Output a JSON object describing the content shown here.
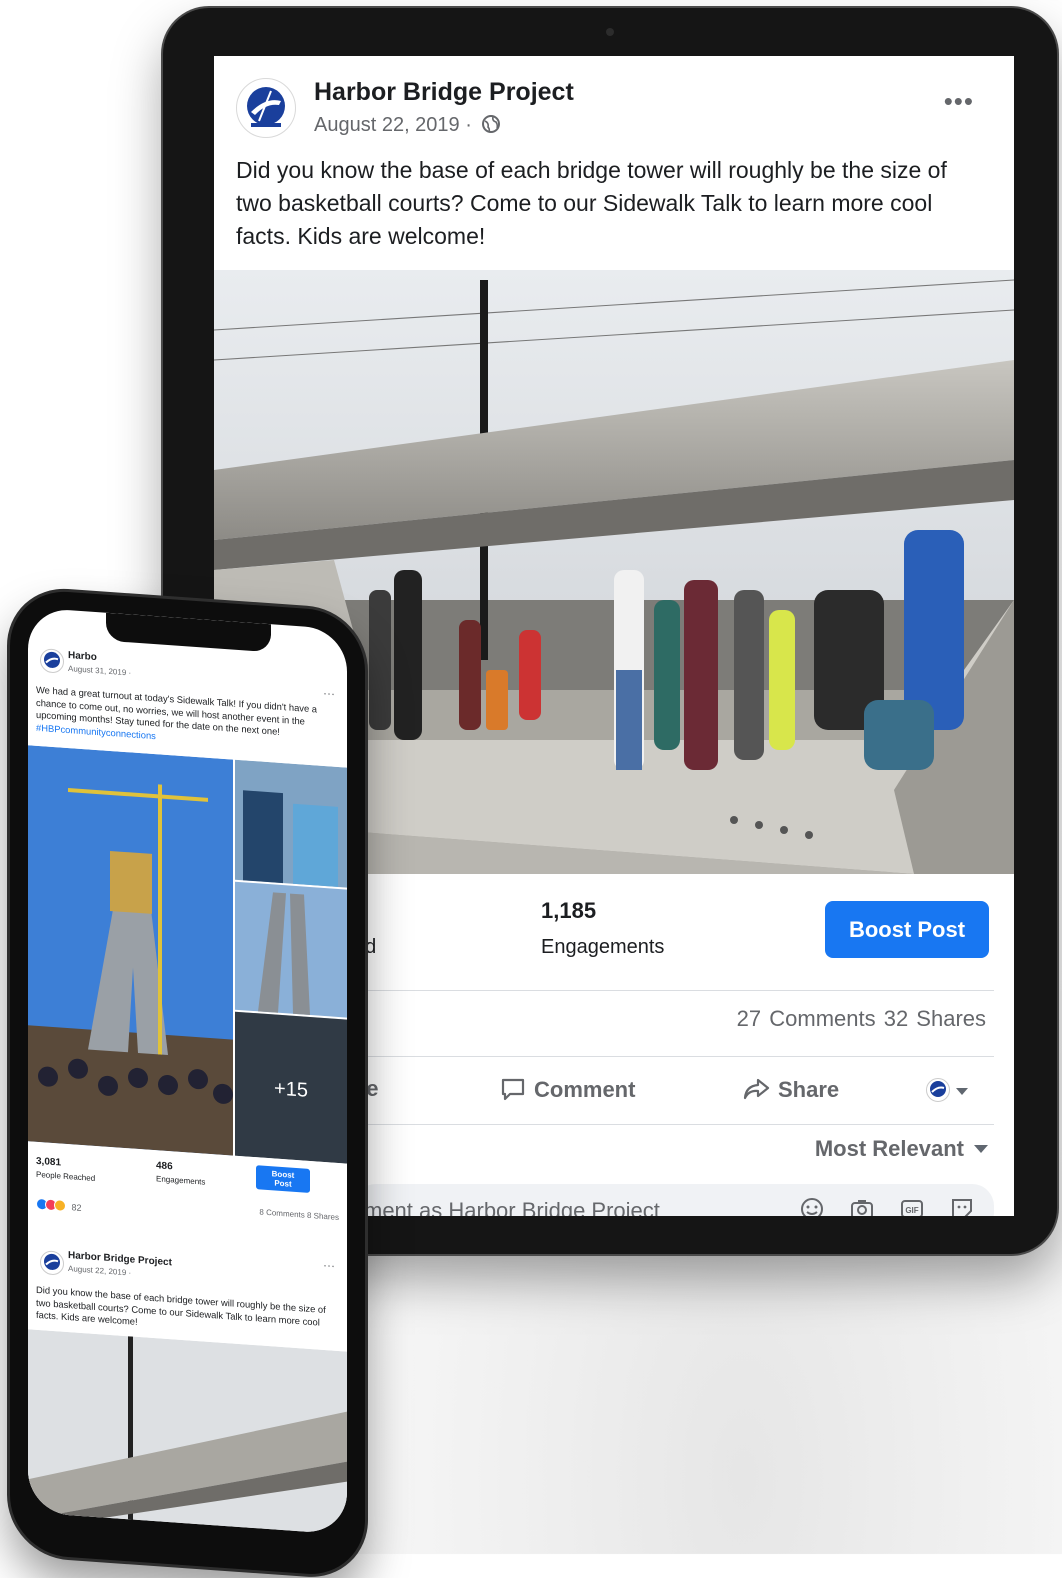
{
  "tablet": {
    "page_name": "Harbor Bridge Project",
    "post_date": "August 22, 2019 ·",
    "post_text": "Did you know the base of each bridge tower will roughly be the size of two basketball courts? Come to our Sidewalk Talk to learn more cool facts. Kids are welcome!",
    "reached_label": "ed",
    "engagements_count": "1,185",
    "engagements_label": "Engagements",
    "boost_label": "Boost Post",
    "counts_left": "",
    "comments_shares": "27 Comments  32 Shares",
    "like_label": "ke",
    "comment_label": "Comment",
    "share_label": "Share",
    "sort_label": "Most Relevant",
    "comment_placeholder": "ment as Harbor Bridge Project"
  },
  "phone": {
    "page_name": "Harbo",
    "post_date": "August 31, 2019 ·",
    "post_text": "We had a great turnout at today's Sidewalk Talk! If you didn't have a chance to come out, no worries, we will host another event in the upcoming months! Stay tuned for the date on the next one!",
    "hashtag": "#HBPcommunityconnections",
    "more_photos": "+15",
    "people_reached_count": "3,081",
    "people_reached_label": "People Reached",
    "engagements_count": "486",
    "engagements_label": "Engagements",
    "boost_label": "Boost Post",
    "reactions_count": "82",
    "comments_shares": "8 Comments  8 Shares",
    "post2_page_name": "Harbor Bridge Project",
    "post2_date": "August 22, 2019 ·",
    "post2_text": "Did you know the base of each bridge tower will roughly be the size of two basketball courts? Come to our Sidewalk Talk to learn more cool facts. Kids are welcome!"
  },
  "colors": {
    "accent": "#1877f2",
    "text": "#1c1e21",
    "muted": "#65676b",
    "device_frame": "#151515"
  },
  "icons": [
    "more-dots-icon",
    "globe-icon",
    "comment-icon",
    "share-icon",
    "emoji-icon",
    "camera-icon",
    "gif-icon",
    "sticker-icon",
    "dropdown-caret-icon"
  ]
}
